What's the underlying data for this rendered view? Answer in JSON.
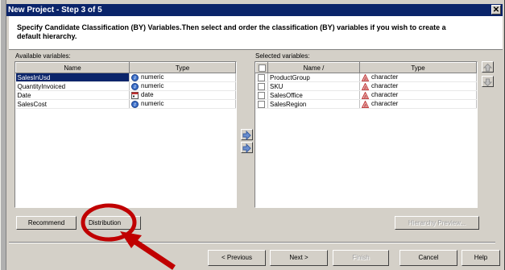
{
  "title": "New Project - Step 3 of 5",
  "instructions": "Specify Candidate Classification (BY) Variables.Then select and order the classification (BY) variables if you wish to create a default hierarchy.",
  "available": {
    "label": "Available variables:",
    "columns": [
      "Name",
      "Type"
    ],
    "rows": [
      {
        "name": "SalesInUsd",
        "type": "numeric",
        "icon": "numeric-icon"
      },
      {
        "name": "QuantityInvoiced",
        "type": "numeric",
        "icon": "numeric-icon"
      },
      {
        "name": "Date",
        "type": "date",
        "icon": "date-icon"
      },
      {
        "name": "SalesCost",
        "type": "numeric",
        "icon": "numeric-icon"
      }
    ]
  },
  "selected": {
    "label": "Selected variables:",
    "columns": [
      "Name /",
      "Type"
    ],
    "rows": [
      {
        "name": "ProductGroup",
        "type": "character",
        "icon": "character-icon"
      },
      {
        "name": "SKU",
        "type": "character",
        "icon": "character-icon"
      },
      {
        "name": "SalesOffice",
        "type": "character",
        "icon": "character-icon"
      },
      {
        "name": "SalesRegion",
        "type": "character",
        "icon": "character-icon"
      }
    ]
  },
  "buttons": {
    "recommend": "Recommend",
    "distribution": "Distribution",
    "hierarchy_preview": "Hierarchy Preview...",
    "previous": "< Previous",
    "next": "Next >",
    "finish": "Finish",
    "cancel": "Cancel",
    "help": "Help"
  },
  "colors": {
    "title_bg": "#0a246a",
    "annotation": "#c00000"
  }
}
